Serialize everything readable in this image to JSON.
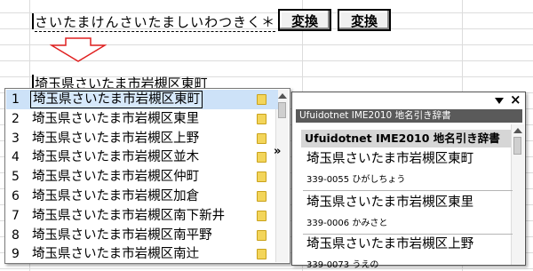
{
  "input": {
    "text": "さいたまけんさいたましいわつきく＊"
  },
  "buttons": {
    "convert1": "変換",
    "convert2": "変換"
  },
  "composed": {
    "seg1": "埼玉県さいたま",
    "seg2": "市岩槻区東町"
  },
  "candidates": [
    {
      "num": "1",
      "text": "埼玉県さいたま市岩槻区東町",
      "selected": true
    },
    {
      "num": "2",
      "text": "埼玉県さいたま市岩槻区東里"
    },
    {
      "num": "3",
      "text": "埼玉県さいたま市岩槻区上野"
    },
    {
      "num": "4",
      "text": "埼玉県さいたま市岩槻区並木"
    },
    {
      "num": "5",
      "text": "埼玉県さいたま市岩槻区仲町"
    },
    {
      "num": "6",
      "text": "埼玉県さいたま市岩槻区加倉"
    },
    {
      "num": "7",
      "text": "埼玉県さいたま市岩槻区南下新井"
    },
    {
      "num": "8",
      "text": "埼玉県さいたま市岩槻区南平野"
    },
    {
      "num": "9",
      "text": "埼玉県さいたま市岩槻区南辻"
    }
  ],
  "expand_glyph": "»",
  "dictionary": {
    "close_glyph": "×",
    "bar_title": "Ufuidotnet IME2010 地名引き辞書",
    "header": "Ufuidotnet IME2010 地名引き辞書",
    "entries": [
      {
        "title": "埼玉県さいたま市岩槻区東町",
        "sub": "339-0055 ひがしちょう"
      },
      {
        "title": "埼玉県さいたま市岩槻区東里",
        "sub": "339-0006 かみさと"
      },
      {
        "title": "埼玉県さいたま市岩槻区上野",
        "sub": "339-0073 うえの"
      }
    ]
  },
  "colors": {
    "selection": "#cde2f8",
    "arrow": "#e02020",
    "note": "#f3d55a"
  }
}
